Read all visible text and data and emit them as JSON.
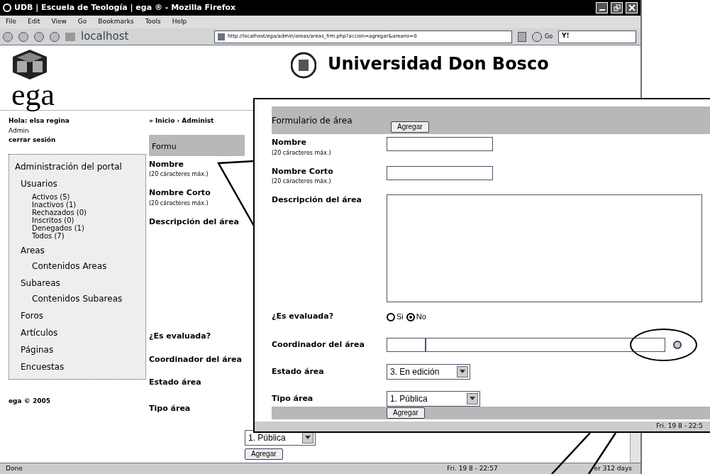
{
  "window": {
    "title": "UDB | Escuela de Teología | ega ® - Mozilla Firefox"
  },
  "menu": [
    "File",
    "Edit",
    "View",
    "Go",
    "Bookmarks",
    "Tools",
    "Help"
  ],
  "toolbar": {
    "home_label": "localhost",
    "url": "http://localhost/ega/admin/areas/areas_frm.php?accion=agregar&areano=0",
    "go_label": "Go",
    "search_label": "Y!"
  },
  "site": {
    "logo_text": "ega",
    "header_title": "Universidad Don Bosco",
    "greeting": "Hola: elsa regina",
    "role": "Admin",
    "logout": "cerrar sesión",
    "footer": "ega © 2005",
    "breadcrumb": "» Inicio › Administ"
  },
  "nav": {
    "title": "Administración del portal",
    "items": [
      {
        "label": "Usuarios",
        "children": [
          {
            "label": "Activos (5)"
          },
          {
            "label": "Inactivos (1)"
          },
          {
            "label": "Rechazados (0)"
          },
          {
            "label": "Inscritos (0)"
          },
          {
            "label": "Denegados (1)"
          },
          {
            "label": "Todos (7)"
          }
        ]
      },
      {
        "label": "Areas",
        "children": [
          {
            "label": "Contenidos Areas"
          }
        ]
      },
      {
        "label": "Subareas",
        "children": [
          {
            "label": "Contenidos Subareas"
          }
        ]
      },
      {
        "label": "Foros"
      },
      {
        "label": "Artículos"
      },
      {
        "label": "Páginas"
      },
      {
        "label": "Encuestas"
      }
    ]
  },
  "background_form": {
    "header": "Formu",
    "labels": [
      {
        "label": "Nombre",
        "hint": "(20 cáracteres máx.)"
      },
      {
        "label": "Nombre Corto",
        "hint": "(20 cáracteres máx.)"
      },
      {
        "label": "Descripción del área"
      },
      {
        "label": "¿Es evaluada?"
      },
      {
        "label": "Coordinador del área"
      },
      {
        "label": "Estado área"
      },
      {
        "label": "Tipo área"
      }
    ],
    "tipo_value": "1. Pública",
    "button": "Agregar"
  },
  "callout_form": {
    "title": "Formulario de área",
    "top_button": "Agregar",
    "nombre": {
      "label": "Nombre",
      "hint": "(20 cáracteres máx.)"
    },
    "nombre_corto": {
      "label": "Nombre Corto",
      "hint": "(20 cáracteres máx.)"
    },
    "descripcion": {
      "label": "Descripción del área"
    },
    "evaluada": {
      "label": "¿Es evaluada?",
      "options": [
        {
          "label": "Si",
          "selected": false
        },
        {
          "label": "No",
          "selected": true
        }
      ]
    },
    "coordinador": {
      "label": "Coordinador del área"
    },
    "estado": {
      "label": "Estado área",
      "value": "3. En edición"
    },
    "tipo": {
      "label": "Tipo área",
      "value": "1. Pública"
    },
    "bottom_button": "Agregar",
    "status_clock": "Fri. 19 8 - 22:5"
  },
  "status_bar": {
    "text": "Done",
    "clock": "Fri. 19 8 - 22:57",
    "right": "er 312 days"
  }
}
